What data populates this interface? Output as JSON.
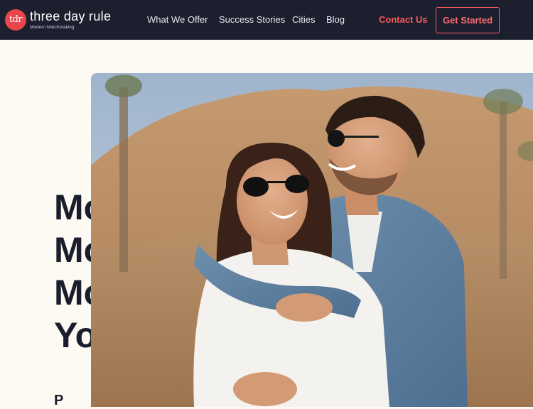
{
  "brand": {
    "logo_initials": "tdr",
    "name": "three day rule",
    "tagline": "Modern Matchmaking"
  },
  "nav": {
    "links": [
      "What We Offer",
      "Success Stories",
      "Cities",
      "Blog"
    ],
    "contact_label": "Contact Us",
    "cta_label": "Get Started"
  },
  "hero": {
    "headline_lines": [
      "Mo",
      "Mo",
      "Mo",
      "Yo"
    ],
    "subline": "P",
    "image_alt": "couple-embracing-in-desert-photo"
  },
  "colors": {
    "nav_bg": "#1b1f2e",
    "accent": "#ff5a5f",
    "page_bg": "#fdf9f3",
    "text_dark": "#1a1d2b"
  }
}
